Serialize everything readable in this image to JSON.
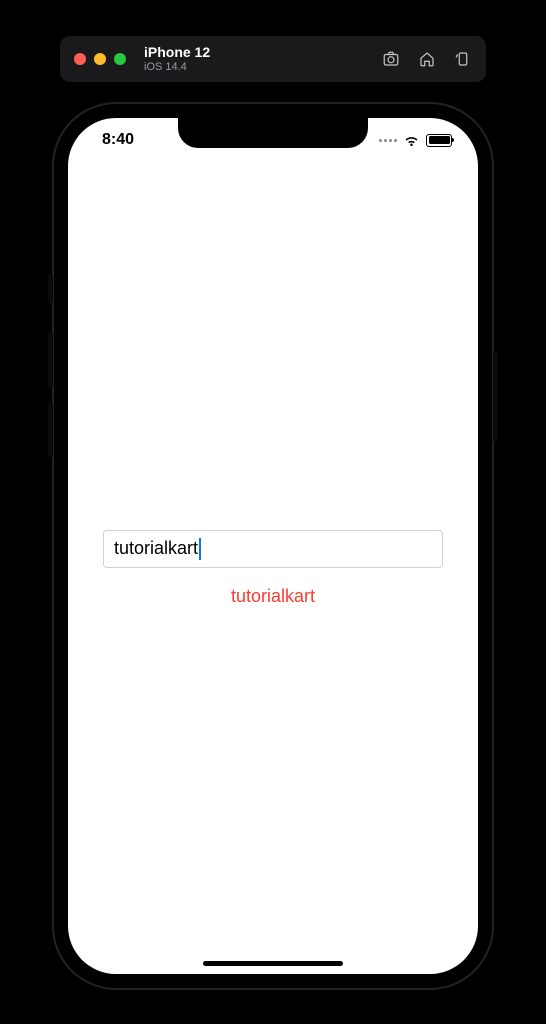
{
  "simulator": {
    "device_name": "iPhone 12",
    "os_version": "iOS 14.4"
  },
  "status_bar": {
    "time": "8:40"
  },
  "app": {
    "textfield_value": "tutorialkart",
    "echo_label": "tutorialkart"
  }
}
